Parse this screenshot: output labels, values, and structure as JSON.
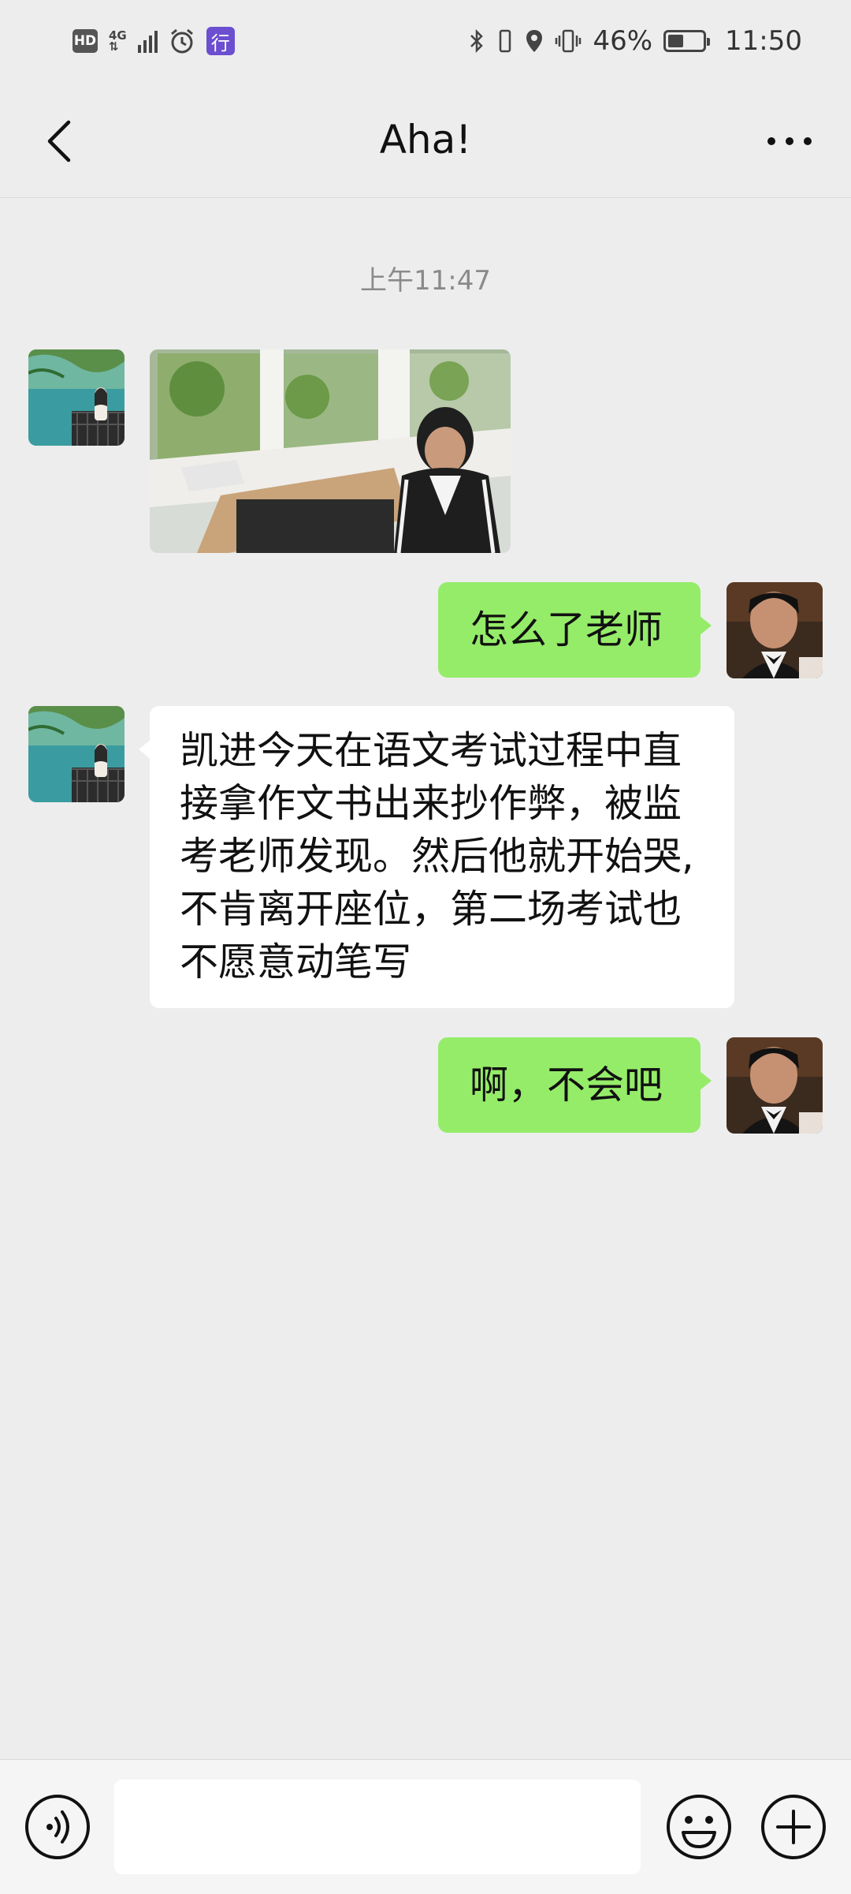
{
  "status_bar": {
    "hd_badge": "HD",
    "network_type": "4G",
    "xing_badge": "行",
    "battery_percent": "46%",
    "battery_level": 0.46,
    "time": "11:50"
  },
  "header": {
    "title": "Aha!",
    "back_icon": "chevron-left-icon",
    "more_icon": "more-dots-icon"
  },
  "chat": {
    "timestamp": "上午11:47",
    "messages": [
      {
        "sender": "contact",
        "type": "image",
        "content": "photo of a boy sitting at a desk near windows with plants"
      },
      {
        "sender": "me",
        "type": "text",
        "text": "怎么了老师"
      },
      {
        "sender": "contact",
        "type": "text",
        "lines": [
          "凯进今天在语文考试过程中直",
          "接拿作文书出来抄作弊，被监",
          "考老师发现。然后他就开始哭,",
          "不肯离开座位，第二场考试也",
          "不愿意动笔写"
        ]
      },
      {
        "sender": "me",
        "type": "text",
        "text": "啊，不会吧"
      }
    ]
  },
  "input_bar": {
    "value": "",
    "placeholder": "",
    "voice_icon": "voice-icon",
    "emoji_icon": "emoji-icon",
    "plus_icon": "plus-icon"
  },
  "colors": {
    "background": "#ededed",
    "bubble_out": "#95ec69",
    "bubble_in": "#ffffff",
    "timestamp": "#8a8a8a"
  }
}
